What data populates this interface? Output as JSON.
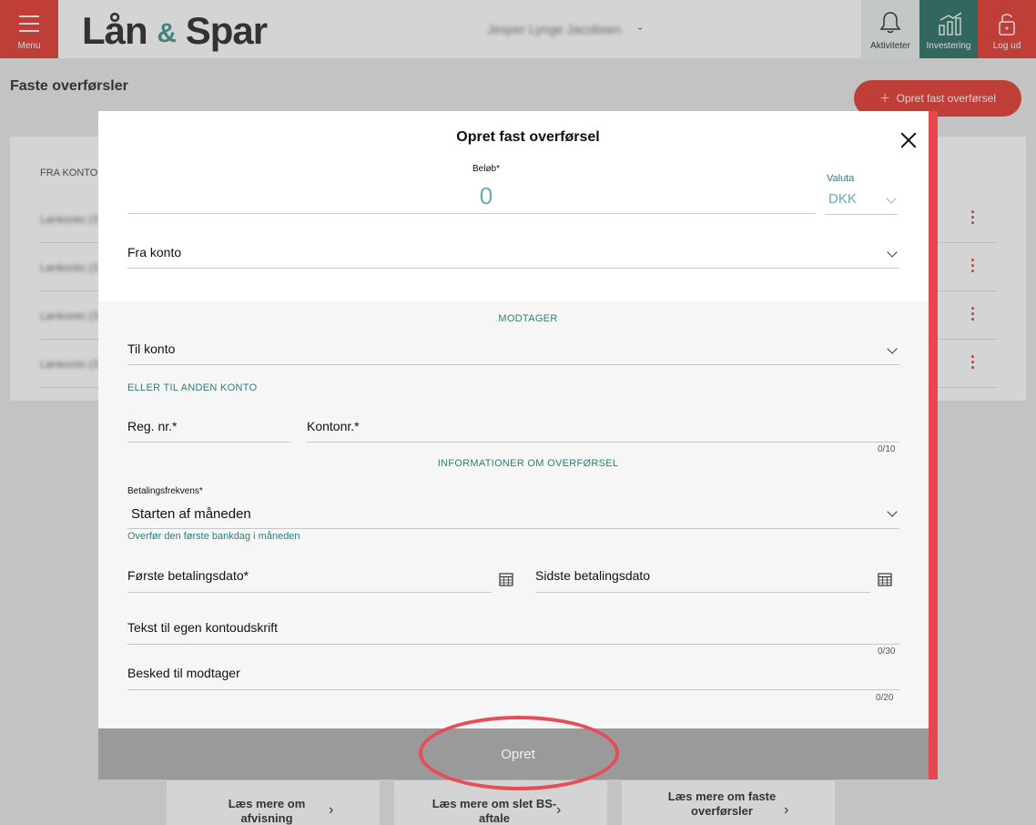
{
  "header": {
    "menu_label": "Menu",
    "logo_left": "Lån",
    "logo_amp": "&",
    "logo_right": "Spar",
    "user_name": "Jesper Lynge Jacobsen",
    "activities_label": "Aktiviteter",
    "investing_label": "Investering",
    "logout_label": "Log ud"
  },
  "page": {
    "title": "Faste overførsler",
    "create_button": "Opret fast overførsel",
    "table_header_from": "FRA KONTO",
    "rows": [
      {
        "account": "Lønkonto (3"
      },
      {
        "account": "Lønkonto (3"
      },
      {
        "account": "Lønkonto (3"
      },
      {
        "account": "Lønkonto (3"
      }
    ],
    "bottom_cards": [
      {
        "title": "Læs mere om afvisning"
      },
      {
        "title": "Læs mere om slet BS-aftale"
      },
      {
        "title": "Læs mere om faste overførsler"
      }
    ]
  },
  "modal": {
    "title": "Opret fast overførsel",
    "amount_label": "Beløb*",
    "amount_value": "0",
    "currency_label": "Valuta",
    "currency_value": "DKK",
    "from_account_label": "Fra konto",
    "receiver_heading": "MODTAGER",
    "to_account_label": "Til konto",
    "other_account_link": "ELLER TIL ANDEN KONTO",
    "reg_label": "Reg. nr.*",
    "account_no_label": "Kontonr.*",
    "account_no_counter": "0/10",
    "transfer_info_heading": "INFORMATIONER OM OVERFØRSEL",
    "frequency_label": "Betalingsfrekvens*",
    "frequency_value": "Starten af måneden",
    "frequency_hint": "Overfør den første bankdag i måneden",
    "first_date_label": "Første betalingsdato*",
    "last_date_label": "Sidste betalingsdato",
    "own_text_label": "Tekst til egen kontoudskrift",
    "own_text_counter": "0/30",
    "message_label": "Besked til modtager",
    "message_counter": "0/20",
    "submit_label": "Opret"
  },
  "colors": {
    "brand_red": "#e2231a",
    "investing_green": "#0f5f52",
    "accent_teal": "#2b7f7a",
    "highlight_ring": "#e84d57"
  }
}
